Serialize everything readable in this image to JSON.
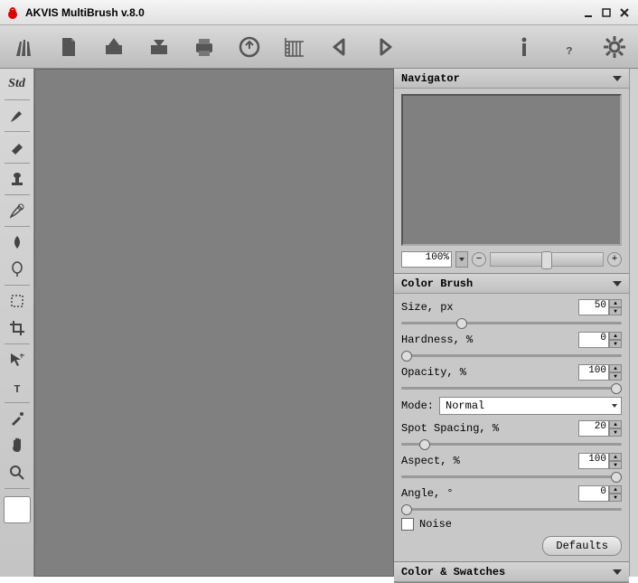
{
  "window": {
    "title": "AKVIS MultiBrush v.8.0"
  },
  "toolbar": {
    "brushes": "brushes",
    "new": "new",
    "open": "open",
    "save": "save",
    "print": "print",
    "web": "import",
    "batch": "batch",
    "back": "back",
    "forward": "forward",
    "info": "info",
    "help": "help",
    "settings": "settings"
  },
  "sidebar": {
    "std_label": "Std"
  },
  "panels": {
    "navigator": {
      "title": "Navigator",
      "zoom_value": "100%"
    },
    "color_brush": {
      "title": "Color Brush",
      "size_label": "Size, px",
      "size_value": "50",
      "hardness_label": "Hardness, %",
      "hardness_value": "0",
      "opacity_label": "Opacity, %",
      "opacity_value": "100",
      "mode_label": "Mode:",
      "mode_value": "Normal",
      "spot_label": "Spot Spacing, %",
      "spot_value": "20",
      "aspect_label": "Aspect, %",
      "aspect_value": "100",
      "angle_label": "Angle, °",
      "angle_value": "0",
      "noise_label": "Noise",
      "defaults_label": "Defaults"
    },
    "swatches": {
      "title": "Color & Swatches"
    }
  }
}
